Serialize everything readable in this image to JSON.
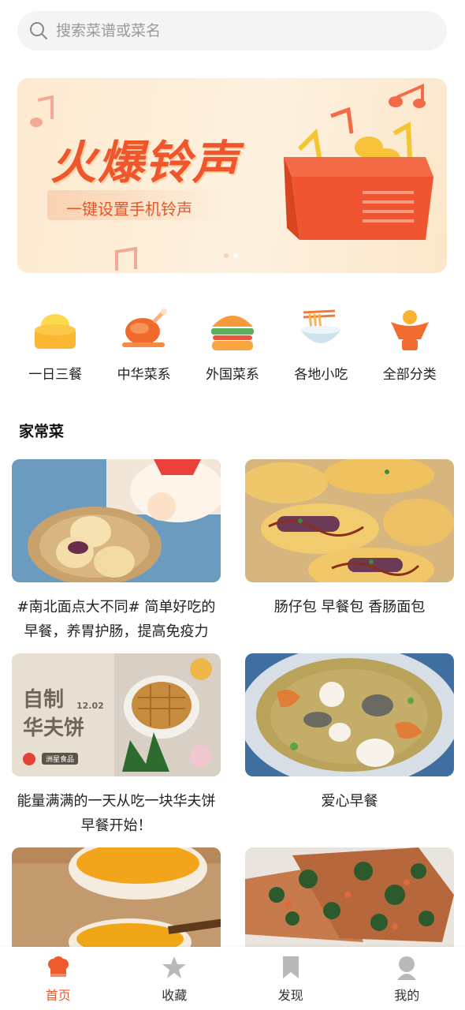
{
  "search": {
    "placeholder": "搜索菜谱或菜名",
    "icon": "search-icon"
  },
  "banner": {
    "title": "火爆铃声",
    "subtitle": "一键设置手机铃声",
    "dots": 2,
    "active_dot": 1
  },
  "categories": [
    {
      "label": "一日三餐",
      "icon": "cake-icon"
    },
    {
      "label": "中华菜系",
      "icon": "roast-chicken-icon"
    },
    {
      "label": "外国菜系",
      "icon": "burger-icon"
    },
    {
      "label": "各地小吃",
      "icon": "noodle-bowl-icon"
    },
    {
      "label": "全部分类",
      "icon": "dish-icon"
    }
  ],
  "section": {
    "title": "家常菜"
  },
  "recipes": [
    {
      "caption": "#南北面点大不同# 简单好吃的早餐，养胃护肠，提高免疫力",
      "image": "pastry-basket"
    },
    {
      "caption": "肠仔包 早餐包 香肠面包",
      "image": "sausage-buns"
    },
    {
      "caption": "能量满满的一天从吃一块华夫饼早餐开始！",
      "image": "waffle",
      "overlay": {
        "title_line1": "自制",
        "title_line2": "华夫饼",
        "date": "12.02",
        "brand": "洲星食品"
      }
    },
    {
      "caption": "爱心早餐",
      "image": "seafood-soup"
    },
    {
      "caption": "",
      "image": "pumpkin-porridge"
    },
    {
      "caption": "",
      "image": "spinach-omelette"
    }
  ],
  "tabs": [
    {
      "label": "首页",
      "icon": "home-chef-hat-icon",
      "active": true
    },
    {
      "label": "收藏",
      "icon": "star-icon",
      "active": false
    },
    {
      "label": "发现",
      "icon": "bookmark-icon",
      "active": false
    },
    {
      "label": "我的",
      "icon": "user-icon",
      "active": false
    }
  ],
  "colors": {
    "accent": "#ef5a2c",
    "banner_bg": "#fdebd2",
    "search_bg": "#f4f4f4"
  }
}
